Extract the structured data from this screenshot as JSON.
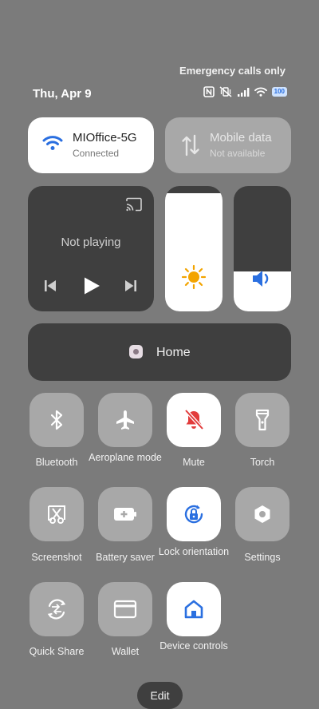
{
  "status_bar": {
    "carrier_text": "Emergency calls only",
    "date": "Thu, Apr 9",
    "battery": "100",
    "icons": [
      "nfc-icon",
      "vibrate-off-icon",
      "signal-icon",
      "wifi-icon",
      "battery-icon"
    ]
  },
  "wifi_tile": {
    "name": "MIOffice-5G",
    "status": "Connected",
    "icon": "wifi-icon",
    "accent": "#2a6fe0"
  },
  "mobile_data_tile": {
    "name": "Mobile data",
    "status": "Not available",
    "icon": "data-arrows-icon"
  },
  "media": {
    "status": "Not playing",
    "icons": [
      "cast-icon",
      "previous-icon",
      "play-icon",
      "next-icon"
    ]
  },
  "brightness": {
    "level": 0.94,
    "icon": "sun-icon",
    "color": "#f3a400"
  },
  "volume": {
    "level": 0.32,
    "icon": "speaker-icon",
    "color": "#2a6fe0"
  },
  "home": {
    "label": "Home"
  },
  "tiles": [
    {
      "label": "Bluetooth",
      "icon": "bluetooth-icon",
      "on": false
    },
    {
      "label": "Aeroplane mode",
      "icon": "airplane-icon",
      "on": false
    },
    {
      "label": "Mute",
      "icon": "mute-bell-icon",
      "on": true,
      "color": "#e23b3b"
    },
    {
      "label": "Torch",
      "icon": "torch-icon",
      "on": false
    },
    {
      "label": "Screenshot",
      "icon": "scissors-icon",
      "on": false
    },
    {
      "label": "Battery saver",
      "icon": "battery-plus-icon",
      "on": false
    },
    {
      "label": "Lock orientation",
      "icon": "rotate-lock-icon",
      "on": true,
      "color": "#2a6fe0"
    },
    {
      "label": "Settings",
      "icon": "gear-icon",
      "on": false
    },
    {
      "label": "Quick Share",
      "icon": "quick-share-icon",
      "on": false
    },
    {
      "label": "Wallet",
      "icon": "wallet-icon",
      "on": false
    },
    {
      "label": "Device controls",
      "icon": "home-icon",
      "on": true,
      "color": "#2a6fe0"
    }
  ],
  "edit_label": "Edit"
}
